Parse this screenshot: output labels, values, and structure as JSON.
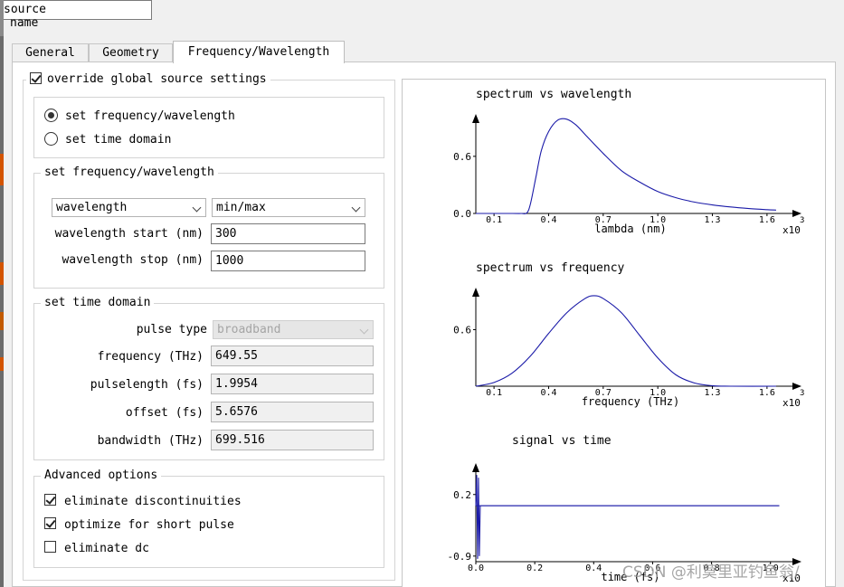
{
  "name_field": {
    "label": "name",
    "value": "source"
  },
  "tabs": [
    {
      "label": "General",
      "active": false
    },
    {
      "label": "Geometry",
      "active": false
    },
    {
      "label": "Frequency/Wavelength",
      "active": true
    }
  ],
  "override": {
    "label": "override global source settings",
    "checked": true
  },
  "mode": {
    "options": [
      {
        "label": "set frequency/wavelength",
        "checked": true
      },
      {
        "label": "set time domain",
        "checked": false
      }
    ]
  },
  "freq_wave": {
    "title": "set frequency/wavelength",
    "type_select": "wavelength",
    "range_select": "min/max",
    "start": {
      "label": "wavelength start (nm)",
      "value": "300"
    },
    "stop": {
      "label": "wavelength stop (nm)",
      "value": "1000"
    }
  },
  "time_domain": {
    "title": "set time domain",
    "pulse_type": {
      "label": "pulse type",
      "value": "broadband"
    },
    "frequency": {
      "label": "frequency (THz)",
      "value": "649.55"
    },
    "pulselength": {
      "label": "pulselength (fs)",
      "value": "1.9954"
    },
    "offset": {
      "label": "offset (fs)",
      "value": "5.6576"
    },
    "bandwidth": {
      "label": "bandwidth (THz)",
      "value": "699.516"
    }
  },
  "advanced": {
    "title": "Advanced options",
    "options": [
      {
        "label": "eliminate discontinuities",
        "checked": true
      },
      {
        "label": "optimize for short pulse",
        "checked": true
      },
      {
        "label": "eliminate dc",
        "checked": false
      }
    ]
  },
  "icons": {
    "dropdown": "chevron-down-icon",
    "checkbox": "checkmark-icon",
    "radio": "radio-dot-icon"
  },
  "colors": {
    "curve": "#1a1aa8",
    "axis": "#000000"
  },
  "watermark": "CSDN @利莫里亚钓鱼翁/",
  "chart_data": [
    {
      "type": "line",
      "title": "spectrum vs wavelength",
      "xlabel": "lambda (nm)",
      "x_multiplier": "x10",
      "x_exponent": "3",
      "xlim": [
        0.0,
        1.7
      ],
      "ylim": [
        0.0,
        0.95
      ],
      "x_ticks": [
        "0.1",
        "0.4",
        "0.7",
        "1.0",
        "1.3",
        "1.6"
      ],
      "y_ticks": [
        "0.0",
        "0.6"
      ],
      "x_tick_values": [
        0.1,
        0.4,
        0.7,
        1.0,
        1.3,
        1.6
      ],
      "y_tick_values": [
        0.0,
        0.6
      ],
      "series": [
        {
          "x": [
            0.0,
            0.2,
            0.25,
            0.28,
            0.3,
            0.33,
            0.36,
            0.4,
            0.45,
            0.5,
            0.55,
            0.6,
            0.7,
            0.8,
            0.9,
            1.0,
            1.1,
            1.2,
            1.3,
            1.4,
            1.5,
            1.6,
            1.65
          ],
          "y": [
            0.0,
            0.0,
            0.0,
            0.005,
            0.1,
            0.38,
            0.66,
            0.86,
            0.98,
            0.99,
            0.93,
            0.83,
            0.63,
            0.45,
            0.33,
            0.23,
            0.165,
            0.12,
            0.09,
            0.068,
            0.052,
            0.04,
            0.035
          ]
        }
      ]
    },
    {
      "type": "line",
      "title": "spectrum vs frequency",
      "xlabel": "frequency (THz)",
      "x_multiplier": "x10",
      "x_exponent": "3",
      "xlim": [
        0.0,
        1.7
      ],
      "ylim": [
        0.0,
        0.95
      ],
      "x_ticks": [
        "0.1",
        "0.4",
        "0.7",
        "1.0",
        "1.3",
        "1.6"
      ],
      "y_ticks": [
        "0.6"
      ],
      "x_tick_values": [
        0.1,
        0.4,
        0.7,
        1.0,
        1.3,
        1.6
      ],
      "y_tick_values": [
        0.6
      ],
      "series": [
        {
          "x": [
            0.0,
            0.1,
            0.2,
            0.3,
            0.4,
            0.5,
            0.6,
            0.65,
            0.7,
            0.8,
            0.9,
            1.0,
            1.1,
            1.2,
            1.3,
            1.4,
            1.65
          ],
          "y": [
            0.0,
            0.04,
            0.14,
            0.32,
            0.56,
            0.78,
            0.93,
            0.96,
            0.93,
            0.78,
            0.54,
            0.3,
            0.12,
            0.035,
            0.005,
            0.0,
            0.0
          ]
        }
      ]
    },
    {
      "type": "line",
      "title": "signal vs time",
      "xlabel": "time (fs)",
      "x_multiplier": "x10",
      "xlim": [
        0.0,
        1.05
      ],
      "ylim": [
        -1.0,
        0.6
      ],
      "x_ticks": [
        "0.0",
        "0.2",
        "0.4",
        "0.6",
        "0.8",
        "1.0"
      ],
      "y_ticks": [
        "0.2",
        "-0.9"
      ],
      "x_tick_values": [
        0.0,
        0.2,
        0.4,
        0.6,
        0.8,
        1.0
      ],
      "y_tick_values": [
        0.2,
        -0.9
      ],
      "series": [
        {
          "x": [
            0.0,
            0.003,
            0.006,
            0.009,
            0.012,
            0.015,
            0.02,
            1.03
          ],
          "y": [
            0.0,
            0.55,
            -0.95,
            0.5,
            -0.9,
            0.0,
            0.0,
            0.0
          ]
        }
      ]
    }
  ]
}
